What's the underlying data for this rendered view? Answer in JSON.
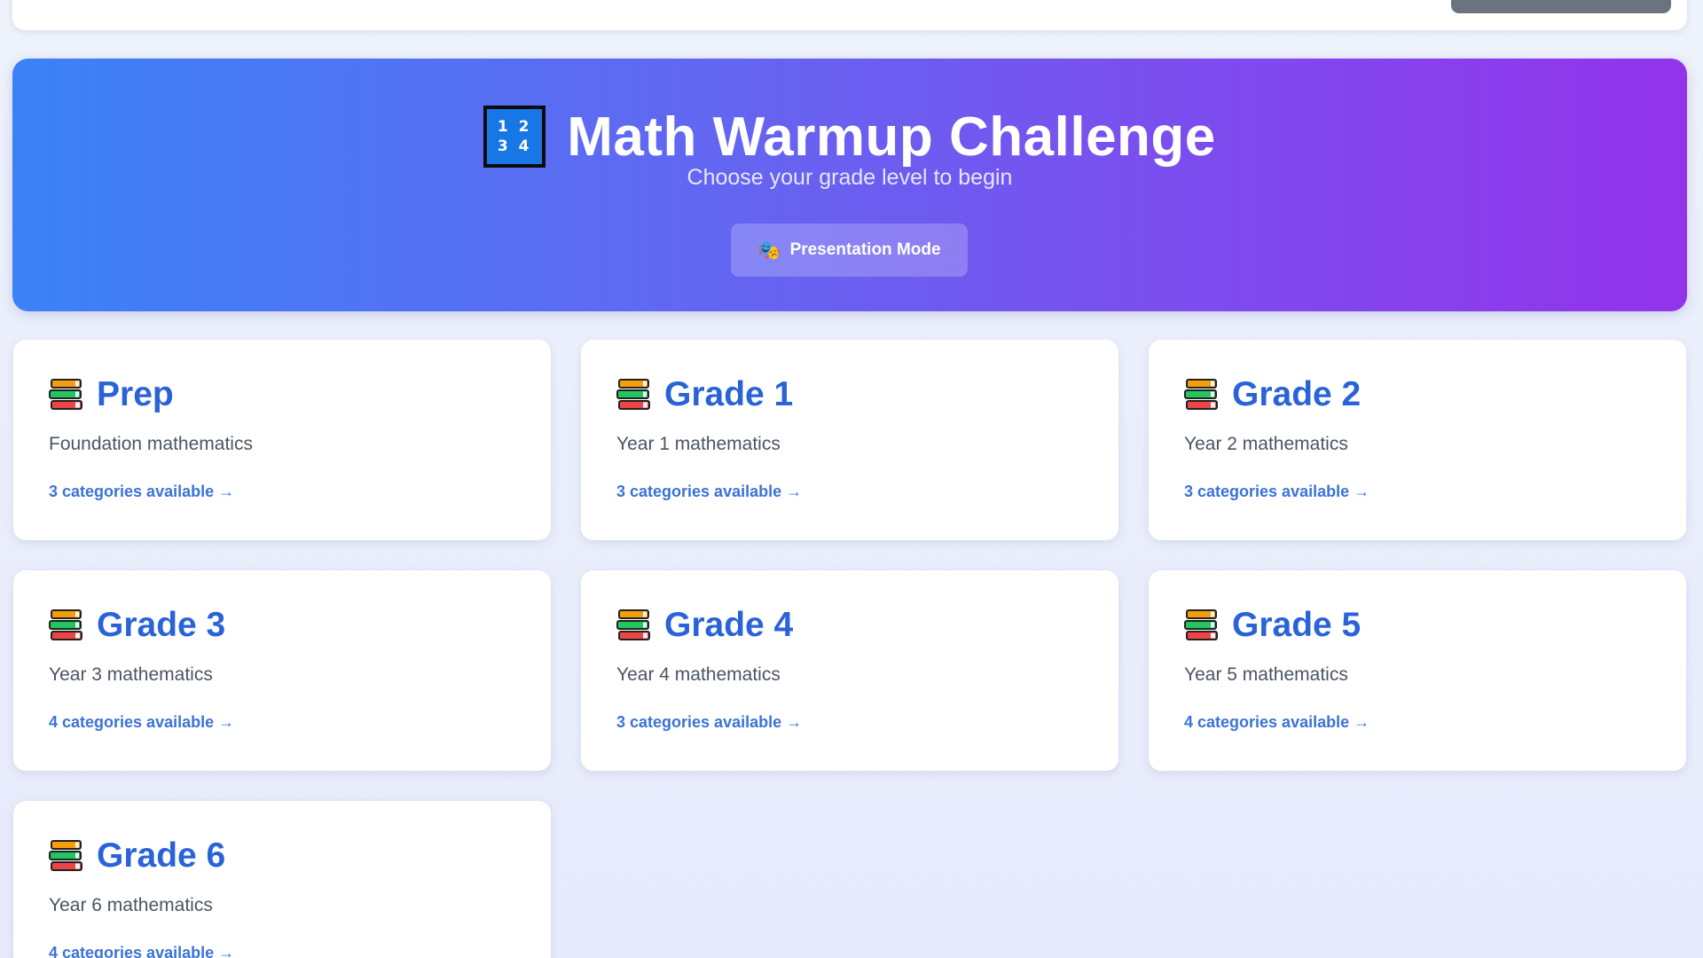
{
  "hero": {
    "title": "Math Warmup Challenge",
    "subtitle": "Choose your grade level to begin",
    "icon": "input-numbers-icon",
    "icon_text_line1": "1 2",
    "icon_text_line2": "3 4",
    "presentation_button_label": "Presentation Mode",
    "presentation_button_icon": "performing-arts-masks-icon"
  },
  "colors": {
    "hero_gradient_start": "#3b82f6",
    "hero_gradient_end": "#9333ea",
    "grade_title": "#2a63d8",
    "link": "#3b73d6",
    "description": "#4b5563",
    "page_background": "#e8ecfb"
  },
  "grades": [
    {
      "icon": "books-icon",
      "title": "Prep",
      "description": "Foundation mathematics",
      "link": "3 categories available →"
    },
    {
      "icon": "books-icon",
      "title": "Grade 1",
      "description": "Year 1 mathematics",
      "link": "3 categories available →"
    },
    {
      "icon": "books-icon",
      "title": "Grade 2",
      "description": "Year 2 mathematics",
      "link": "3 categories available →"
    },
    {
      "icon": "books-icon",
      "title": "Grade 3",
      "description": "Year 3 mathematics",
      "link": "4 categories available →"
    },
    {
      "icon": "books-icon",
      "title": "Grade 4",
      "description": "Year 4 mathematics",
      "link": "3 categories available →"
    },
    {
      "icon": "books-icon",
      "title": "Grade 5",
      "description": "Year 5 mathematics",
      "link": "4 categories available →"
    },
    {
      "icon": "books-icon",
      "title": "Grade 6",
      "description": "Year 6 mathematics",
      "link": "4 categories available →"
    }
  ]
}
